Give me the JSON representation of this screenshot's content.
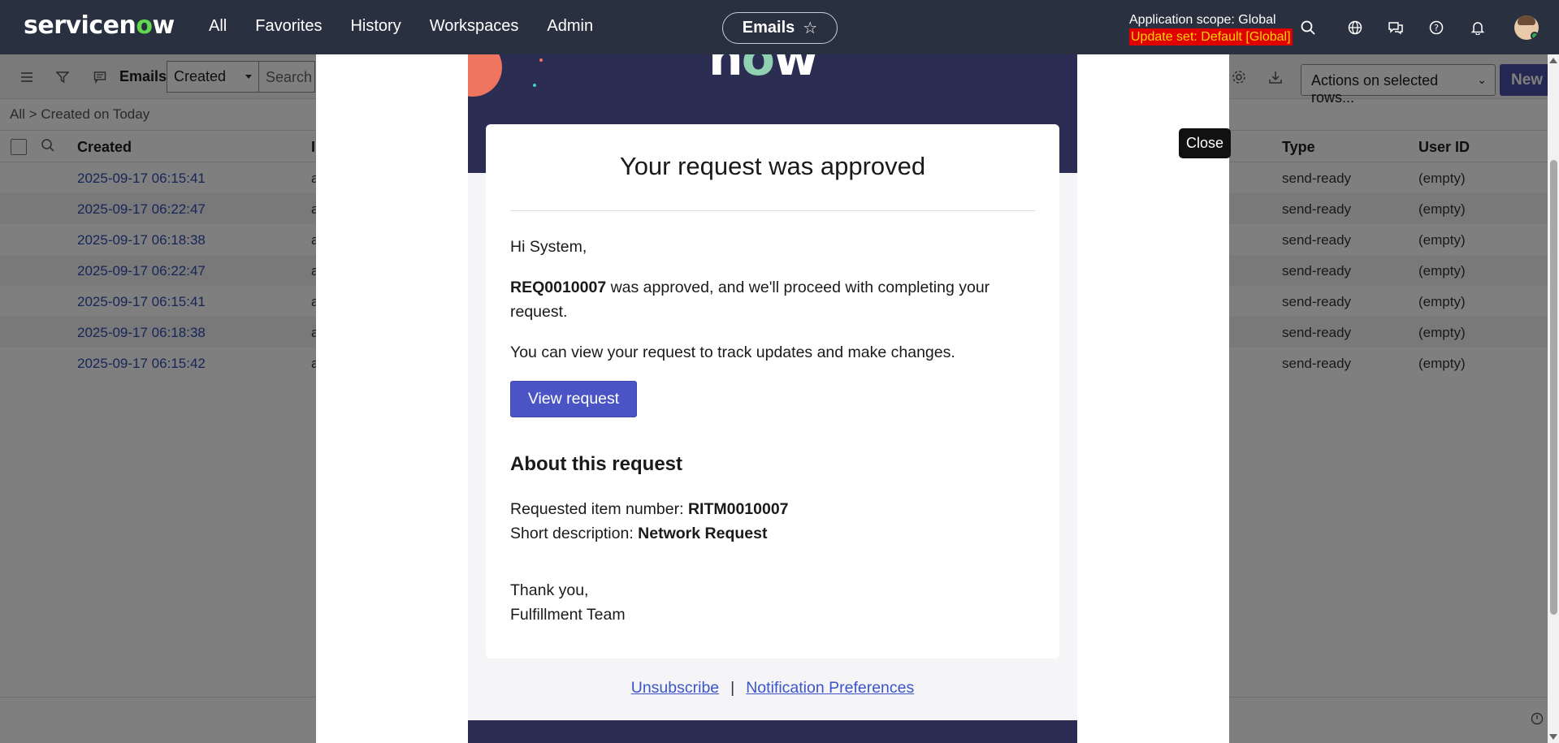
{
  "topnav": {
    "logo_pre": "servicen",
    "logo_o": "o",
    "logo_post": "w",
    "menu": [
      "All",
      "Favorites",
      "History",
      "Workspaces",
      "Admin"
    ],
    "context_title": "Emails",
    "scope_label": "Application scope: Global",
    "update_set": "Update set: Default [Global]",
    "icons": [
      "search-icon",
      "globe-icon",
      "chat-icon",
      "help-icon",
      "bell-icon"
    ]
  },
  "listbar": {
    "title": "Emails",
    "filter_field": "Created",
    "search_placeholder": "Search",
    "actions_select": "Actions on selected rows...",
    "new_button": "New"
  },
  "breadcrumb": {
    "root": "All",
    "sep": ">",
    "current": "Created on Today"
  },
  "table": {
    "columns": {
      "created": "Created",
      "second": "I",
      "type": "Type",
      "user_id": "User ID"
    },
    "rows": [
      {
        "created": "2025-09-17 06:15:41",
        "mid": "a",
        "type": "send-ready",
        "user_id": "(empty)"
      },
      {
        "created": "2025-09-17 06:22:47",
        "mid": "a",
        "type": "send-ready",
        "user_id": "(empty)"
      },
      {
        "created": "2025-09-17 06:18:38",
        "mid": "a",
        "type": "send-ready",
        "user_id": "(empty)"
      },
      {
        "created": "2025-09-17 06:22:47",
        "mid": "a",
        "type": "send-ready",
        "user_id": "(empty)"
      },
      {
        "created": "2025-09-17 06:15:41",
        "mid": "a",
        "type": "send-ready",
        "user_id": "(empty)"
      },
      {
        "created": "2025-09-17 06:18:38",
        "mid": "a",
        "type": "send-ready",
        "user_id": "(empty)"
      },
      {
        "created": "2025-09-17 06:15:42",
        "mid": "a",
        "type": "send-ready",
        "user_id": "(empty)"
      }
    ]
  },
  "email": {
    "brand_pre": "n",
    "brand_o": "o",
    "brand_post": "w",
    "heading": "Your request was approved",
    "greeting": "Hi System,",
    "req_number": "REQ0010007",
    "approved_text": " was approved, and we'll proceed with completing your request.",
    "view_text": "You can view your request to track updates and make changes.",
    "button": "View request",
    "about_heading": "About this request",
    "item_label": "Requested item number: ",
    "item_value": "RITM0010007",
    "desc_label": "Short description: ",
    "desc_value": "Network Request",
    "thanks": "Thank you,",
    "team": "Fulfillment Team",
    "unsubscribe": "Unsubscribe",
    "sep": "|",
    "preferences": "Notification Preferences"
  },
  "close_tooltip": "Close",
  "colors": {
    "nav_bg": "#293040",
    "accent": "#4b54c5",
    "link": "#2e4db3",
    "update_set_bg": "#e00000",
    "update_set_fg": "#ffd400",
    "email_banner": "#2b2d52"
  }
}
